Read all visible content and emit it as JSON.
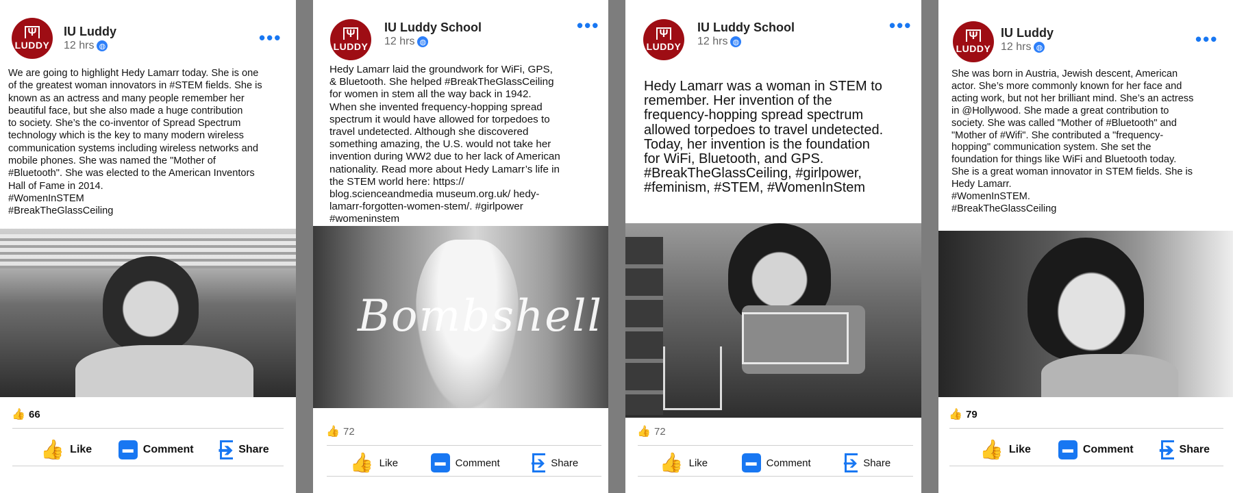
{
  "posts": [
    {
      "page_name": "IU Luddy",
      "time": "12 hrs",
      "text": "We are going to highlight Hedy Lamarr today. She is one\nof the greatest woman innovators in #STEM fields. She is\nknown as an actress and many people remember her\nbeautiful face, but she also made a huge   contribution\nto society. She’s the co-inventor of Spread Spectrum\ntechnology which is the key to many modern wireless\ncommunication systems including wireless networks and\nmobile phones. She was named the \"Mother of\n#Bluetooth\". She was elected to the American Inventors\nHall of Fame in 2014.\n #WomenInSTEM\n#BreakTheGlassCeiling",
      "likes": "66",
      "actions": {
        "like": "Like",
        "comment": "Comment",
        "share": "Share"
      }
    },
    {
      "page_name": "IU Luddy School",
      "time": "12 hrs",
      "text": "Hedy Lamarr laid the groundwork for WiFi, GPS,\n& Bluetooth. She helped #BreakTheGlassCeiling\nfor women in stem all the way back in 1942.\nWhen she invented frequency-hopping spread\nspectrum it would have allowed for torpedoes to\ntravel undetected. Although she discovered\nsomething amazing, the U.S. would not take her\ninvention during WW2 due to her lack of American\nnationality. Read more about Hedy Lamarr’s life in\nthe STEM world here: https://\nblog.scienceandmedia museum.org.uk/ hedy-\nlamarr-forgotten-women-stem/. #girlpower\n#womeninstem",
      "photo_caption": "Bombshell",
      "likes": "72",
      "actions": {
        "like": "Like",
        "comment": "Comment",
        "share": "Share"
      }
    },
    {
      "page_name": "IU Luddy School",
      "time": "12 hrs",
      "text": "Hedy Lamarr was a woman in STEM to\nremember. Her invention of the\nfrequency-hopping spread spectrum\nallowed torpedoes to travel undetected.\nToday, her invention is the foundation\nfor WiFi, Bluetooth, and GPS.\n#BreakTheGlassCeiling, #girlpower,\n#feminism, #STEM, #WomenInStem",
      "likes": "72",
      "actions": {
        "like": "Like",
        "comment": "Comment",
        "share": "Share"
      }
    },
    {
      "page_name": "IU Luddy",
      "time": "12 hrs",
      "text": "She was born in Austria, Jewish descent, American\nactor. She’s more commonly known for her face and\nacting work, but not her brilliant mind. She’s an actress\nin @Hollywood. She made a great contribution to\nsociety. She was called \"Mother of #Bluetooth\" and\n\"Mother of #Wifi\". She contributed a \"frequency-\nhopping\" communication system. She set the\nfoundation for things like WiFi and Bluetooth today.\nShe is a great woman innovator in STEM fields. She is\nHedy Lamarr.\n #WomenInSTEM.\n#BreakTheGlassCeiling",
      "likes": "79",
      "actions": {
        "like": "Like",
        "comment": "Comment",
        "share": "Share"
      }
    }
  ],
  "logo_text": "LUDDY",
  "logo_mark": "Ψ",
  "colors": {
    "brand_red": "#9e0d14",
    "accent_blue": "#1877f2",
    "gutter": "#7d7d7d"
  }
}
